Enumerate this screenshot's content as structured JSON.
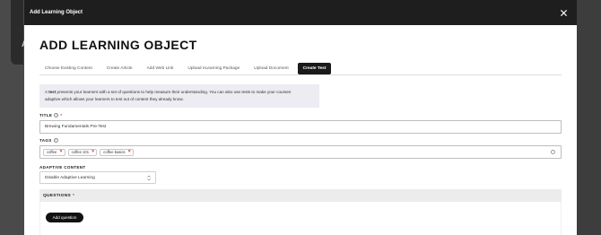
{
  "background": {
    "letter": "A"
  },
  "modal": {
    "title": "Add Learning Object"
  },
  "heading": "ADD LEARNING OBJECT",
  "tabs": [
    {
      "label": "Choose Existing Content"
    },
    {
      "label": "Create Article"
    },
    {
      "label": "Add Web Link"
    },
    {
      "label": "Upload eLearning Package"
    },
    {
      "label": "Upload Document"
    },
    {
      "label": "Create Test",
      "active": true
    }
  ],
  "info": {
    "prefix": "A ",
    "bold": "test",
    "line1": " presents your learners with a set of questions to help measure their understanding. You can also use tests to make your courses",
    "line2": "adaptive which allows your learners to test out of content they already know."
  },
  "title_field": {
    "label": "TITLE",
    "required_mark": "*",
    "value": "Brewing Fundamentals Pre-Test"
  },
  "tags_field": {
    "label": "TAGS",
    "tags": [
      "coffee",
      "coffee 101",
      "coffee basics"
    ],
    "remove_glyph": "×"
  },
  "adaptive": {
    "label": "ADAPTIVE CONTENT",
    "selected": "Disable Adaptive Learning"
  },
  "questions": {
    "label": "QUESTIONS",
    "required_mark": "*",
    "add_button": "Add question"
  },
  "icons": {
    "close": "close-icon",
    "help": "help-icon",
    "caret": "select-caret-icon"
  },
  "colors": {
    "header_bg": "#1e1e1e",
    "accent": "#d4691f",
    "required": "#c0392b"
  }
}
